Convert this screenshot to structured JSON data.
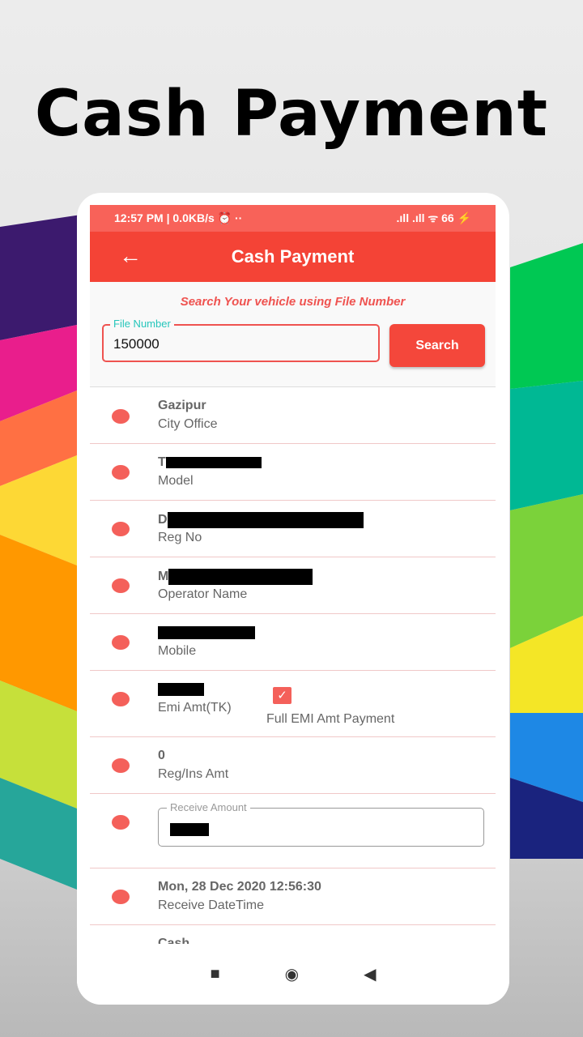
{
  "headline": "Cash Payment",
  "status": {
    "left": "12:57 PM | 0.0KB/s ⏰ ··",
    "right": ".ıll .ıll ᯤ 66 ⚡",
    "battery": "66"
  },
  "appbar": {
    "title": "Cash Payment",
    "back_icon": "←"
  },
  "search": {
    "hint": "Search Your vehicle using File Number",
    "field_label": "File Number",
    "field_value": "150000",
    "button": "Search"
  },
  "rows": [
    {
      "value": "Gazipur",
      "label": "City Office"
    },
    {
      "value": "T",
      "label": "Model"
    },
    {
      "value": "D",
      "label": "Reg No"
    },
    {
      "value": "M",
      "label": "Operator Name"
    },
    {
      "value": "",
      "label": "Mobile"
    },
    {
      "value": "",
      "label": "Emi Amt(TK)",
      "checkbox_label": "Full EMI Amt Payment",
      "checked": true
    },
    {
      "value": "0",
      "label": "Reg/Ins Amt"
    },
    {
      "field_label": "Receive Amount"
    },
    {
      "value": "Mon, 28 Dec 2020 12:56:30",
      "label": "Receive DateTime"
    },
    {
      "value": "Cash"
    }
  ],
  "nav": {
    "recent": "■",
    "home": "◉",
    "back": "◀"
  },
  "colors": {
    "accent": "#f44336",
    "status": "#f86259",
    "dot": "#f4605a",
    "label_teal": "#26c6bb"
  }
}
